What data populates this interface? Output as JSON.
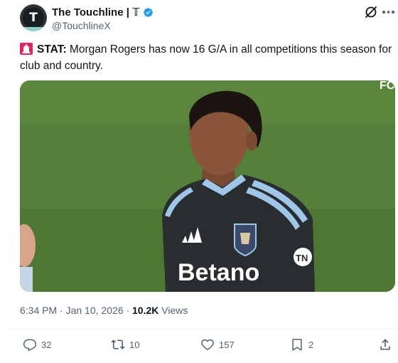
{
  "author": {
    "display_name": "The Touchline | 𝕋",
    "handle": "@TouchlineX",
    "avatar_letter": "T",
    "verified": true,
    "verified_color": "#1d9bf0"
  },
  "tweet": {
    "emoji": "rotating-light-icon",
    "label": "STAT:",
    "text": " Morgan Rogers has now 16 G/A in all competitions this season for club and country."
  },
  "media": {
    "type": "photo",
    "kit_sponsor": "Betano",
    "kit_badge": "TN",
    "corner_text": "FC"
  },
  "meta": {
    "time": "6:34 PM",
    "separator": "·",
    "date": "Jan 10, 2026",
    "views_count": "10.2K",
    "views_label": "Views"
  },
  "actions": {
    "replies": "32",
    "reposts": "10",
    "likes": "157",
    "bookmarks": "2"
  },
  "colors": {
    "text_primary": "#0f1419",
    "text_secondary": "#536471",
    "accent": "#1d9bf0"
  }
}
